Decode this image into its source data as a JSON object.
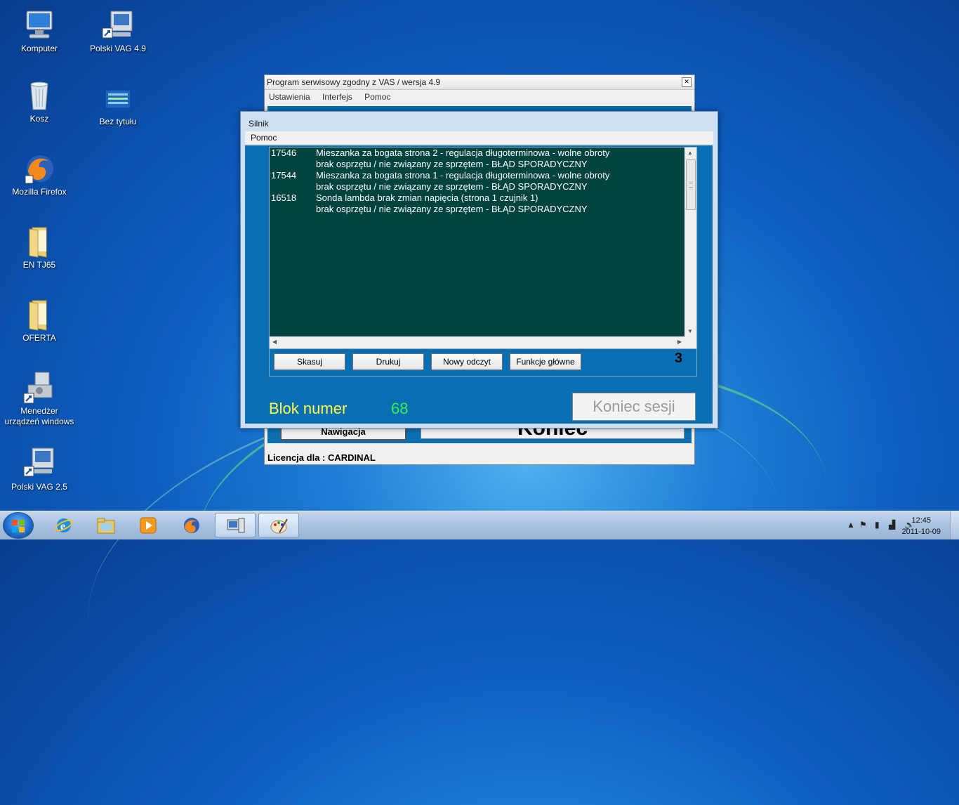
{
  "desktop": {
    "icons": [
      {
        "label": "Komputer",
        "icon": "computer-icon"
      },
      {
        "label": "Polski VAG 4.9",
        "icon": "vag-shortcut-icon"
      },
      {
        "label": "Kosz",
        "icon": "recycle-bin-icon"
      },
      {
        "label": "Bez tytułu",
        "icon": "document-icon"
      },
      {
        "label": "Mozilla Firefox",
        "icon": "firefox-icon"
      },
      {
        "label": "EN TJ65",
        "icon": "folder-icon"
      },
      {
        "label": "OFERTA",
        "icon": "folder-icon"
      },
      {
        "label": "Menedżer urządzeń windows",
        "icon": "device-manager-icon"
      },
      {
        "label": "Polski VAG 2.5",
        "icon": "vag-shortcut-icon"
      }
    ]
  },
  "main_window": {
    "title": "Program serwisowy zgodny z VAS / wersja 4.9",
    "menu": [
      "Ustawienia",
      "Interfejs",
      "Pomoc"
    ],
    "nav_button": "Nawigacja",
    "big_button": "Koniec",
    "status": "Licencja dla : CARDINAL"
  },
  "dialog": {
    "title": "Silnik",
    "menu": [
      "Pomoc"
    ],
    "faults": [
      {
        "code": "17546",
        "text": "Mieszanka za bogata strona 2 - regulacja długoterminowa - wolne obroty",
        "detail": "brak osprzętu / nie związany ze sprzętem  -  BŁĄD SPORADYCZNY"
      },
      {
        "code": "17544",
        "text": "Mieszanka za bogata strona 1 - regulacja długoterminowa - wolne obroty",
        "detail": "brak osprzętu / nie związany ze sprzętem  -  BŁĄD SPORADYCZNY"
      },
      {
        "code": "16518",
        "text": "Sonda lambda brak zmian napięcia (strona 1 czujnik 1)",
        "detail": "brak osprzętu / nie związany ze sprzętem  -  BŁĄD SPORADYCZNY"
      }
    ],
    "buttons": [
      "Skasuj",
      "Drukuj",
      "Nowy odczyt",
      "Funkcje główne"
    ],
    "fault_count": "3",
    "blok_label": "Blok numer",
    "blok_value": "68",
    "end_session": "Koniec sesji"
  },
  "taskbar": {
    "pinned": [
      "internet-explorer-icon",
      "explorer-folder-icon",
      "media-player-icon",
      "firefox-icon",
      "vag-app-icon",
      "paint-icon"
    ],
    "time": "12:45",
    "date": "2011-10-09"
  },
  "colors": {
    "list_background": "#00433f",
    "dialog_body": "#0a6fb2",
    "blok_label": "#ffff44",
    "blok_value": "#33ee55"
  }
}
